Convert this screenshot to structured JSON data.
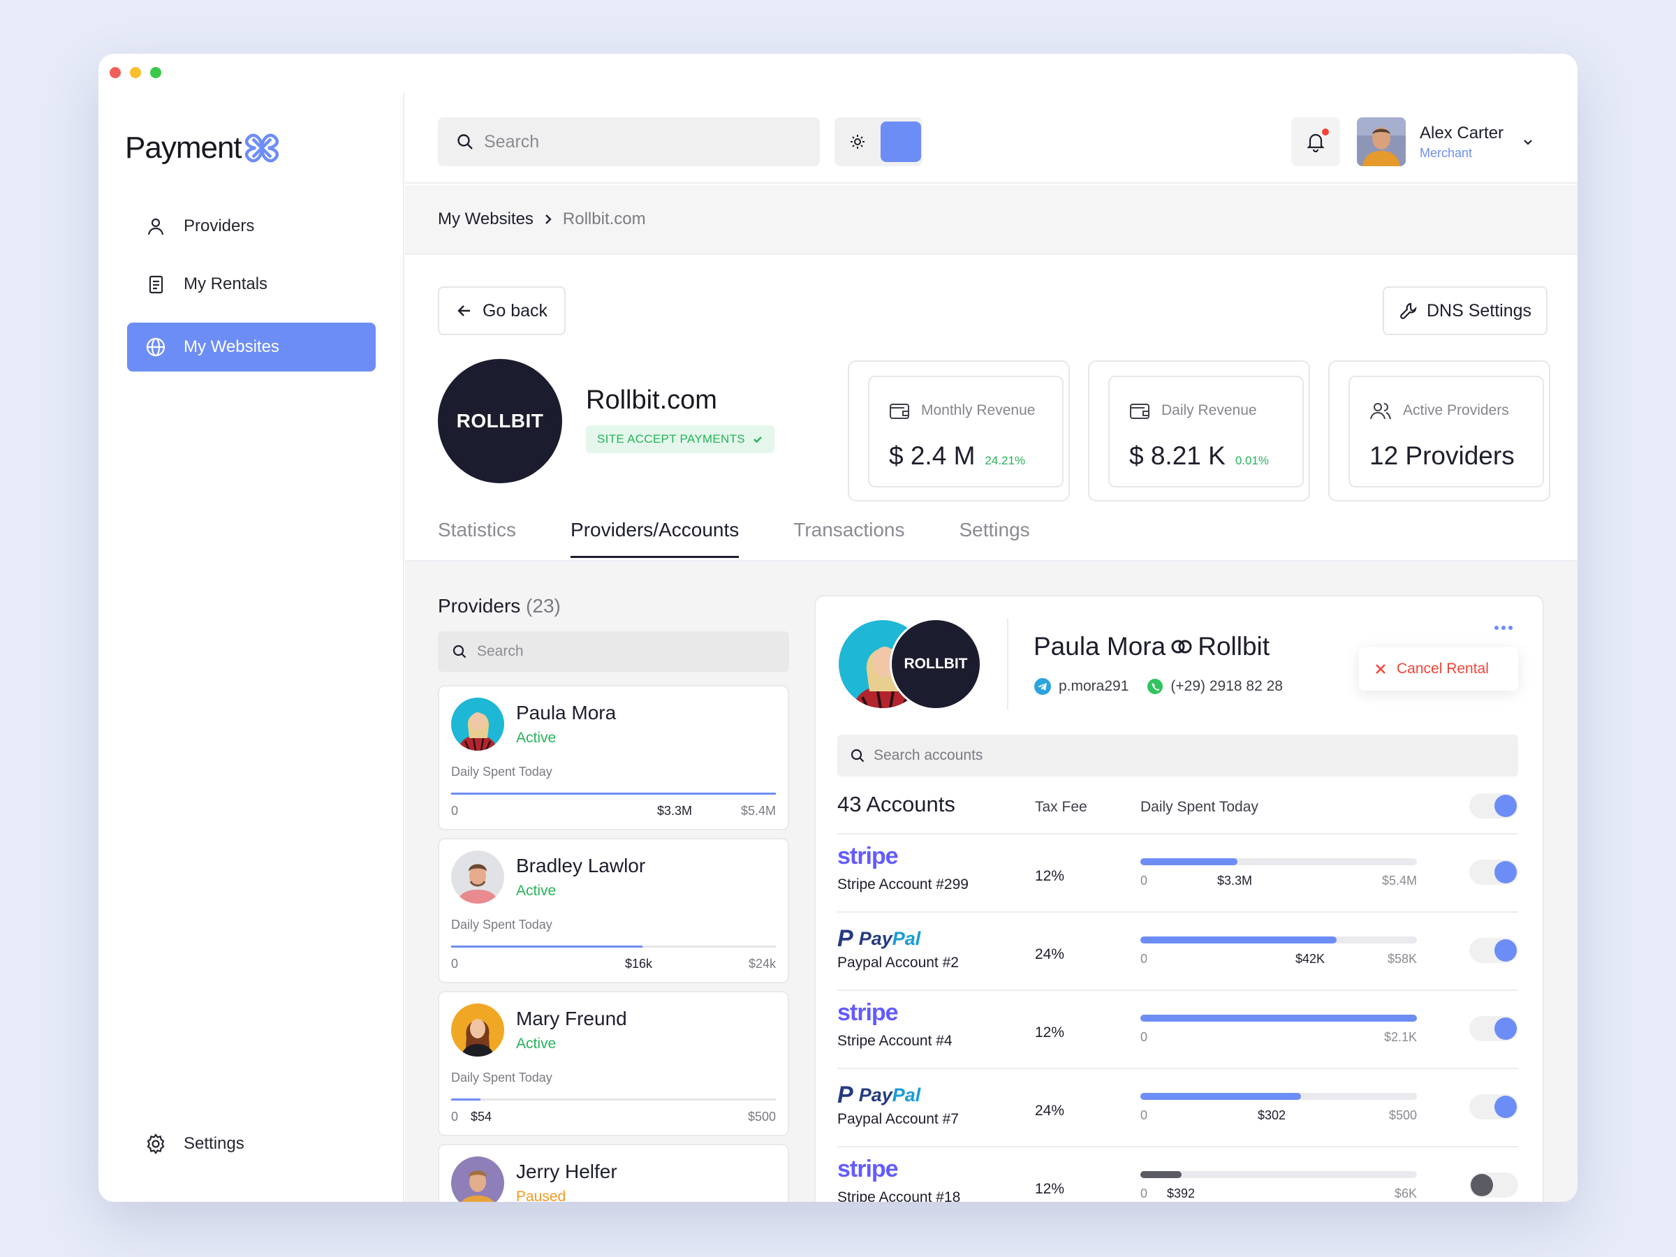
{
  "app": {
    "logo_text": "Payment"
  },
  "sidebar": {
    "items": [
      {
        "label": "Providers",
        "icon": "user-icon"
      },
      {
        "label": "My Rentals",
        "icon": "document-icon"
      },
      {
        "label": "My Websites",
        "icon": "globe-icon"
      }
    ],
    "settings_label": "Settings"
  },
  "topbar": {
    "search_placeholder": "Search",
    "user": {
      "name": "Alex Carter",
      "role": "Merchant"
    }
  },
  "breadcrumb": {
    "parent": "My Websites",
    "current": "Rollbit.com"
  },
  "actions": {
    "go_back": "Go back",
    "dns_settings": "DNS Settings"
  },
  "site": {
    "logo_text": "ROLLBIT",
    "title": "Rollbit.com",
    "badge": "SITE ACCEPT PAYMENTS"
  },
  "stats": [
    {
      "label": "Monthly Revenue",
      "value": "$ 2.4 M",
      "change": "24.21%"
    },
    {
      "label": "Daily Revenue",
      "value": "$ 8.21 K",
      "change": "0.01%"
    },
    {
      "label": "Active Providers",
      "value": "12 Providers"
    }
  ],
  "tabs": [
    "Statistics",
    "Providers/Accounts",
    "Transactions",
    "Settings"
  ],
  "providers": {
    "heading": "Providers",
    "count": "(23)",
    "search_placeholder": "Search",
    "spent_label": "Daily Spent Today",
    "list": [
      {
        "name": "Paula Mora",
        "status": "Active",
        "min": "0",
        "current": "$3.3M",
        "max": "$5.4M",
        "progress": 1.0
      },
      {
        "name": "Bradley Lawlor",
        "status": "Active",
        "min": "0",
        "current": "$16k",
        "max": "$24k",
        "progress": 0.59
      },
      {
        "name": "Mary Freund",
        "status": "Active",
        "min": "0",
        "current": "$54",
        "max": "$500",
        "progress": 0.09
      },
      {
        "name": "Jerry Helfer",
        "status": "Paused"
      }
    ]
  },
  "detail": {
    "name": "Paula Mora",
    "partner": "Rollbit",
    "partner_logo": "ROLLBIT",
    "telegram": "p.mora291",
    "phone": "(+29) 2918 82 28",
    "cancel_label": "Cancel Rental",
    "search_placeholder": "Search accounts",
    "accounts_count": "43 Accounts",
    "col_tax": "Tax Fee",
    "col_spent": "Daily Spent Today",
    "accounts": [
      {
        "brand": "stripe",
        "name": "Stripe Account #299",
        "tax": "12%",
        "min": "0",
        "current": "$3.3M",
        "max": "$5.4M",
        "progress": 0.35,
        "enabled": true
      },
      {
        "brand": "paypal",
        "name": "Paypal Account #2",
        "tax": "24%",
        "min": "0",
        "current": "$42K",
        "max": "$58K",
        "progress": 0.71,
        "enabled": true
      },
      {
        "brand": "stripe",
        "name": "Stripe Account #4",
        "tax": "12%",
        "min": "0",
        "current": "",
        "max": "$2.1K",
        "progress": 1.0,
        "enabled": true
      },
      {
        "brand": "paypal",
        "name": "Paypal Account #7",
        "tax": "24%",
        "min": "0",
        "current": "$302",
        "max": "$500",
        "progress": 0.58,
        "enabled": true
      },
      {
        "brand": "stripe",
        "name": "Stripe Account #18",
        "tax": "12%",
        "min": "0",
        "current": "$392",
        "max": "$6K",
        "progress": 0.15,
        "enabled": false
      }
    ]
  },
  "brands": {
    "stripe": "stripe",
    "paypal_a": "Pay",
    "paypal_b": "Pal",
    "paypal_p": "P"
  },
  "colors": {
    "accent": "#6d8df6",
    "success": "#26b35a",
    "danger": "#f44336",
    "warning": "#f59a23"
  }
}
